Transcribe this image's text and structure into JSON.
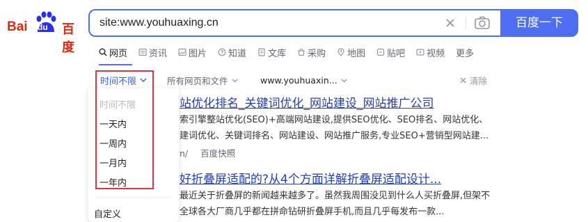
{
  "logo": {
    "bai": "Bai",
    "du": "du",
    "cn": "百度"
  },
  "search": {
    "query": "site:www.youhuaxing.cn",
    "button_label": "百度一下"
  },
  "tabs": [
    {
      "label": "网页",
      "icon": "search-icon"
    },
    {
      "label": "资讯",
      "icon": "news-icon"
    },
    {
      "label": "图片",
      "icon": "image-icon"
    },
    {
      "label": "知道",
      "icon": "question-icon"
    },
    {
      "label": "文库",
      "icon": "document-icon"
    },
    {
      "label": "采购",
      "icon": "shopping-icon"
    },
    {
      "label": "地图",
      "icon": "location-icon"
    },
    {
      "label": "贴吧",
      "icon": "tieba-icon"
    },
    {
      "label": "视频",
      "icon": "video-icon"
    },
    {
      "label": "更多",
      "icon": ""
    }
  ],
  "filters": {
    "time": "时间不限",
    "scope": "所有网页和文件",
    "site": "www.youhuaxin...",
    "clear": "清除"
  },
  "time_dropdown": {
    "items": [
      "时间不限",
      "一天内",
      "一周内",
      "一月内",
      "一年内"
    ],
    "custom": "自定义"
  },
  "results": [
    {
      "title": "站优化排名_关键词优化_网站建设_网站推广公司",
      "lines": [
        "索引擎整站优化(SEO)+高端网站建设,提供SEO优化、SEO排名、网站优化、",
        "建词优化、关键词排名、网站建设、网站推广服务,专业SEO+营销型网站建..."
      ],
      "meta_prefix": "n/",
      "snapshot": "百度快照"
    },
    {
      "title": "好折叠屏适配的?从4个方面详解折叠屏适配设计...",
      "lines": [
        "最近关于折叠屏的新闻越来越多了。虽然我周围没见到什么人买折叠屏,但架不",
        "全球各大厂商几乎都在拼命钻研折叠屏手机,而且几乎每发布一款..."
      ]
    }
  ],
  "colors": {
    "brand_blue": "#4e6ef2",
    "link_blue": "#2440b3",
    "baidu_red": "#de2910",
    "highlight_red": "#e0333c"
  }
}
